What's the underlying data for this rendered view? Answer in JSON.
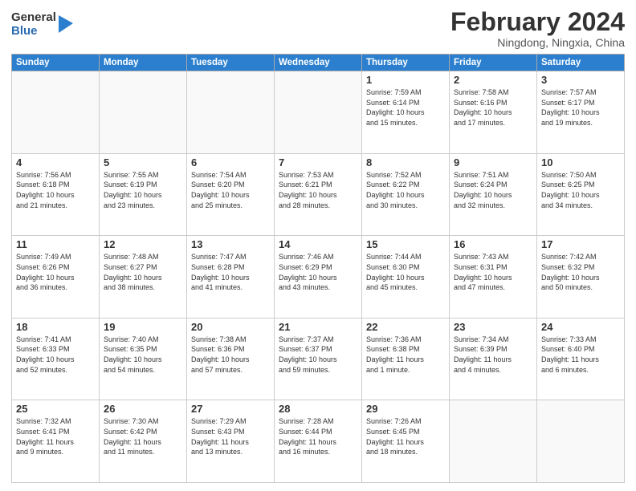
{
  "header": {
    "logo": {
      "general": "General",
      "blue": "Blue"
    },
    "title": "February 2024",
    "subtitle": "Ningdong, Ningxia, China"
  },
  "weekdays": [
    "Sunday",
    "Monday",
    "Tuesday",
    "Wednesday",
    "Thursday",
    "Friday",
    "Saturday"
  ],
  "weeks": [
    [
      {
        "day": "",
        "info": ""
      },
      {
        "day": "",
        "info": ""
      },
      {
        "day": "",
        "info": ""
      },
      {
        "day": "",
        "info": ""
      },
      {
        "day": "1",
        "info": "Sunrise: 7:59 AM\nSunset: 6:14 PM\nDaylight: 10 hours\nand 15 minutes."
      },
      {
        "day": "2",
        "info": "Sunrise: 7:58 AM\nSunset: 6:16 PM\nDaylight: 10 hours\nand 17 minutes."
      },
      {
        "day": "3",
        "info": "Sunrise: 7:57 AM\nSunset: 6:17 PM\nDaylight: 10 hours\nand 19 minutes."
      }
    ],
    [
      {
        "day": "4",
        "info": "Sunrise: 7:56 AM\nSunset: 6:18 PM\nDaylight: 10 hours\nand 21 minutes."
      },
      {
        "day": "5",
        "info": "Sunrise: 7:55 AM\nSunset: 6:19 PM\nDaylight: 10 hours\nand 23 minutes."
      },
      {
        "day": "6",
        "info": "Sunrise: 7:54 AM\nSunset: 6:20 PM\nDaylight: 10 hours\nand 25 minutes."
      },
      {
        "day": "7",
        "info": "Sunrise: 7:53 AM\nSunset: 6:21 PM\nDaylight: 10 hours\nand 28 minutes."
      },
      {
        "day": "8",
        "info": "Sunrise: 7:52 AM\nSunset: 6:22 PM\nDaylight: 10 hours\nand 30 minutes."
      },
      {
        "day": "9",
        "info": "Sunrise: 7:51 AM\nSunset: 6:24 PM\nDaylight: 10 hours\nand 32 minutes."
      },
      {
        "day": "10",
        "info": "Sunrise: 7:50 AM\nSunset: 6:25 PM\nDaylight: 10 hours\nand 34 minutes."
      }
    ],
    [
      {
        "day": "11",
        "info": "Sunrise: 7:49 AM\nSunset: 6:26 PM\nDaylight: 10 hours\nand 36 minutes."
      },
      {
        "day": "12",
        "info": "Sunrise: 7:48 AM\nSunset: 6:27 PM\nDaylight: 10 hours\nand 38 minutes."
      },
      {
        "day": "13",
        "info": "Sunrise: 7:47 AM\nSunset: 6:28 PM\nDaylight: 10 hours\nand 41 minutes."
      },
      {
        "day": "14",
        "info": "Sunrise: 7:46 AM\nSunset: 6:29 PM\nDaylight: 10 hours\nand 43 minutes."
      },
      {
        "day": "15",
        "info": "Sunrise: 7:44 AM\nSunset: 6:30 PM\nDaylight: 10 hours\nand 45 minutes."
      },
      {
        "day": "16",
        "info": "Sunrise: 7:43 AM\nSunset: 6:31 PM\nDaylight: 10 hours\nand 47 minutes."
      },
      {
        "day": "17",
        "info": "Sunrise: 7:42 AM\nSunset: 6:32 PM\nDaylight: 10 hours\nand 50 minutes."
      }
    ],
    [
      {
        "day": "18",
        "info": "Sunrise: 7:41 AM\nSunset: 6:33 PM\nDaylight: 10 hours\nand 52 minutes."
      },
      {
        "day": "19",
        "info": "Sunrise: 7:40 AM\nSunset: 6:35 PM\nDaylight: 10 hours\nand 54 minutes."
      },
      {
        "day": "20",
        "info": "Sunrise: 7:38 AM\nSunset: 6:36 PM\nDaylight: 10 hours\nand 57 minutes."
      },
      {
        "day": "21",
        "info": "Sunrise: 7:37 AM\nSunset: 6:37 PM\nDaylight: 10 hours\nand 59 minutes."
      },
      {
        "day": "22",
        "info": "Sunrise: 7:36 AM\nSunset: 6:38 PM\nDaylight: 11 hours\nand 1 minute."
      },
      {
        "day": "23",
        "info": "Sunrise: 7:34 AM\nSunset: 6:39 PM\nDaylight: 11 hours\nand 4 minutes."
      },
      {
        "day": "24",
        "info": "Sunrise: 7:33 AM\nSunset: 6:40 PM\nDaylight: 11 hours\nand 6 minutes."
      }
    ],
    [
      {
        "day": "25",
        "info": "Sunrise: 7:32 AM\nSunset: 6:41 PM\nDaylight: 11 hours\nand 9 minutes."
      },
      {
        "day": "26",
        "info": "Sunrise: 7:30 AM\nSunset: 6:42 PM\nDaylight: 11 hours\nand 11 minutes."
      },
      {
        "day": "27",
        "info": "Sunrise: 7:29 AM\nSunset: 6:43 PM\nDaylight: 11 hours\nand 13 minutes."
      },
      {
        "day": "28",
        "info": "Sunrise: 7:28 AM\nSunset: 6:44 PM\nDaylight: 11 hours\nand 16 minutes."
      },
      {
        "day": "29",
        "info": "Sunrise: 7:26 AM\nSunset: 6:45 PM\nDaylight: 11 hours\nand 18 minutes."
      },
      {
        "day": "",
        "info": ""
      },
      {
        "day": "",
        "info": ""
      }
    ]
  ]
}
